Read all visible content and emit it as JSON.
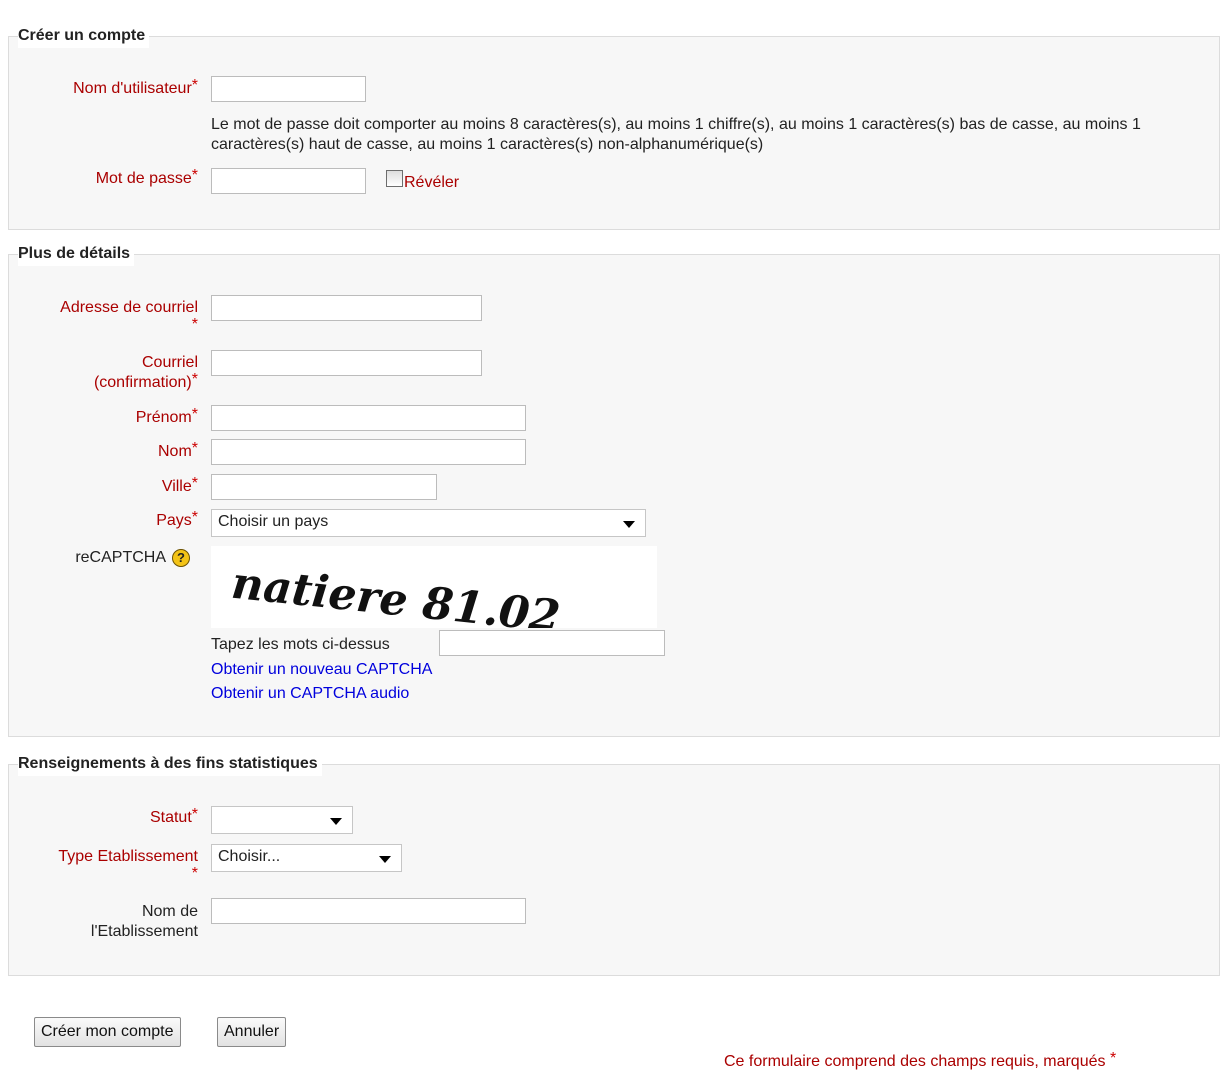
{
  "section_account": {
    "legend": "Créer un compte",
    "username_label": "Nom d'utilisateur",
    "password_rule": "Le mot de passe doit comporter au moins 8 caractères(s), au moins 1 chiffre(s), au moins 1 caractères(s) bas de casse, au moins 1 caractères(s) haut de casse, au moins 1 caractères(s) non-alphanumérique(s)",
    "password_label": "Mot de passe",
    "reveal_label": "Révéler"
  },
  "section_details": {
    "legend": "Plus de détails",
    "email_label": "Adresse de courriel",
    "email_confirm_label_1": "Courriel",
    "email_confirm_label_2": "(confirmation)",
    "firstname_label": "Prénom",
    "lastname_label": "Nom",
    "city_label": "Ville",
    "country_label": "Pays",
    "country_value": "Choisir un pays",
    "recaptcha_label": "reCAPTCHA",
    "captcha_text": "natiere 81.02",
    "captcha_prompt": "Tapez les mots ci-dessus",
    "new_captcha_link": "Obtenir un nouveau CAPTCHA",
    "audio_captcha_link": "Obtenir un CAPTCHA audio"
  },
  "section_stats": {
    "legend": "Renseignements à des fins statistiques",
    "status_label": "Statut",
    "status_value": "",
    "type_label": "Type Etablissement",
    "type_value": "Choisir...",
    "name_label_1": "Nom de",
    "name_label_2": "l'Etablissement"
  },
  "buttons": {
    "submit": "Créer mon compte",
    "cancel": "Annuler"
  },
  "footer_note": "Ce formulaire comprend des champs requis, marqués",
  "required_marker": "*"
}
